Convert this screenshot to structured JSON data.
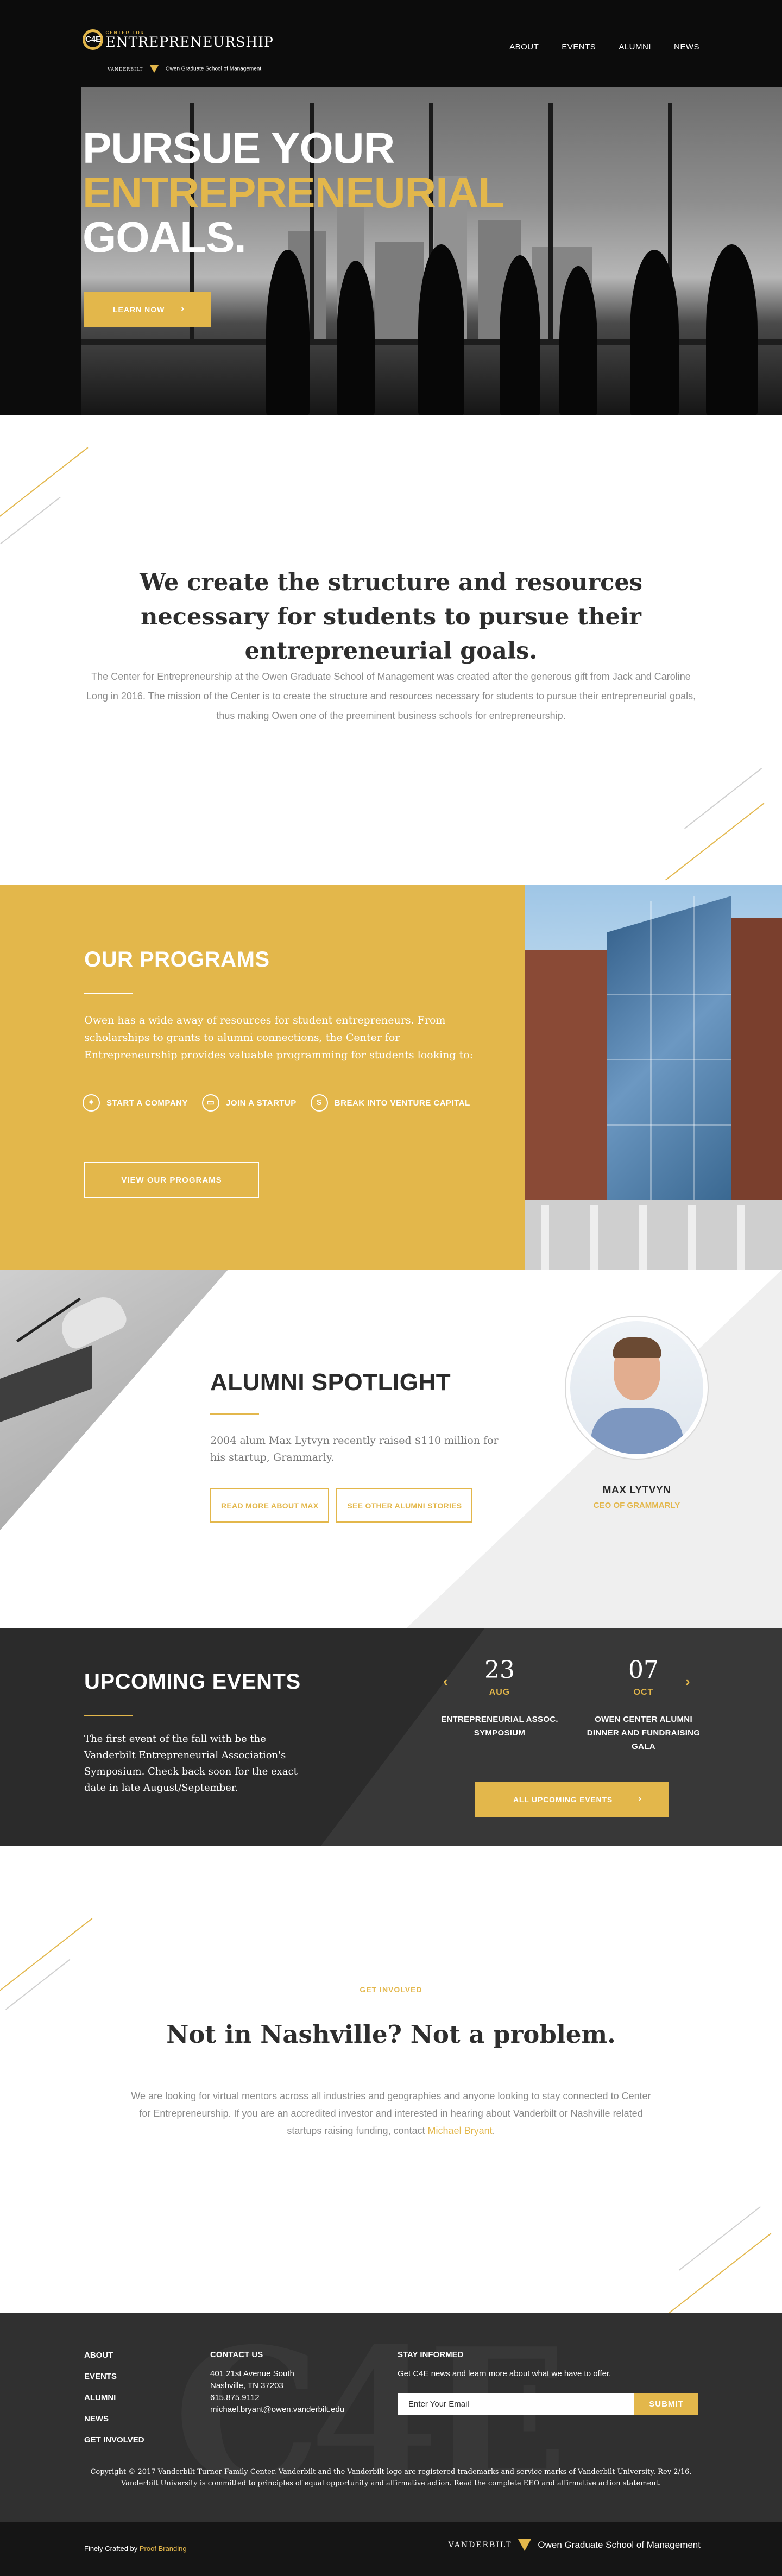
{
  "logo": {
    "mark": "C4E",
    "small": "CENTER FOR",
    "big": "ENTREPRENEURSHIP",
    "vanderbilt": "VANDERBILT",
    "school": "Owen Graduate School of Management"
  },
  "nav": {
    "items": [
      "ABOUT",
      "EVENTS",
      "ALUMNI",
      "NEWS"
    ]
  },
  "hero": {
    "line1": "PURSUE YOUR",
    "line2": "ENTREPRENEURIAL",
    "line3": "GOALS.",
    "button": "LEARN NOW",
    "chev": "›"
  },
  "mission": {
    "headline": "We create the structure and resources necessary for students to pursue their entrepreneurial goals.",
    "body": "The Center for Entrepreneurship at the Owen Graduate School of Management was created after the generous gift from Jack and Caroline Long in 2016. The mission of the Center is to create the structure and resources necessary for students to pursue their entrepreneurial goals, thus making Owen one of the preeminent business schools for entrepreneurship."
  },
  "programs": {
    "title": "OUR PROGRAMS",
    "body": "Owen has a wide away of resources for student entrepreneurs. From scholarships to grants to alumni connections, the Center for Entrepreneurship provides valuable programming for students looking to:",
    "items": [
      {
        "label": "START A COMPANY",
        "icon": "lightbulb-icon",
        "glyph": "✦"
      },
      {
        "label": "JOIN A STARTUP",
        "icon": "handshake-icon",
        "glyph": "▭"
      },
      {
        "label": "BREAK INTO VENTURE CAPITAL",
        "icon": "dollar-icon",
        "glyph": "$"
      }
    ],
    "button": "VIEW OUR PROGRAMS"
  },
  "alumni": {
    "title": "ALUMNI SPOTLIGHT",
    "body": "2004 alum Max Lytvyn recently raised $110 million for his startup, Grammarly.",
    "button1": "READ MORE ABOUT MAX",
    "button2": "SEE OTHER ALUMNI STORIES",
    "name": "MAX LYTVYN",
    "role": "CEO OF GRAMMARLY"
  },
  "events": {
    "title": "UPCOMING EVENTS",
    "body": "The first event of the fall with be the Vanderbilt Entrepreneurial Association's Symposium. Check back soon for the exact date in late August/September.",
    "prev": "‹",
    "next": "›",
    "items": [
      {
        "day": "23",
        "month": "AUG",
        "name": "ENTREPRENEURIAL ASSOC. SYMPOSIUM"
      },
      {
        "day": "07",
        "month": "OCT",
        "name": "OWEN CENTER ALUMNI DINNER AND FUNDRAISING GALA"
      }
    ],
    "button": "ALL UPCOMING EVENTS",
    "chev": "›"
  },
  "involved": {
    "kicker": "GET INVOLVED",
    "headline": "Not in Nashville? Not a problem.",
    "body": "We are looking for virtual mentors across all industries and geographies and anyone looking to stay connected to Center for Entrepreneurship. If you are an accredited investor and interested in hearing about Vanderbilt or Nashville related startups raising funding, contact",
    "link": "Michael Bryant",
    "end": "."
  },
  "footer": {
    "links": [
      "ABOUT",
      "EVENTS",
      "ALUMNI",
      "NEWS",
      "GET INVOLVED"
    ],
    "contact_title": "CONTACT US",
    "address1": "401 21st Avenue South",
    "address2": "Nashville, TN 37203",
    "phone": "615.875.9112",
    "email": "michael.bryant@owen.vanderbilt.edu",
    "stay_title": "STAY INFORMED",
    "stay_body": "Get C4E news and learn more about what we have to offer.",
    "email_placeholder": "Enter Your Email",
    "submit": "SUBMIT",
    "legal": "Copyright © 2017 Vanderbilt Turner Family Center. Vanderbilt and the Vanderbilt logo are registered trademarks and service marks of Vanderbilt University. Rev 2/16. Vanderbilt University is committed to principles of equal opportunity and affirmative action. Read the complete EEO and affirmative action statement."
  },
  "bottom": {
    "credit_prefix": "Finely Crafted by",
    "credit_name": "Proof Branding",
    "vanderbilt": "VANDERBILT",
    "school": "Owen Graduate School of Management"
  },
  "colors": {
    "accent": "#e3b74b",
    "dark": "#2b2b2b",
    "hero": "#0c0c0c"
  }
}
